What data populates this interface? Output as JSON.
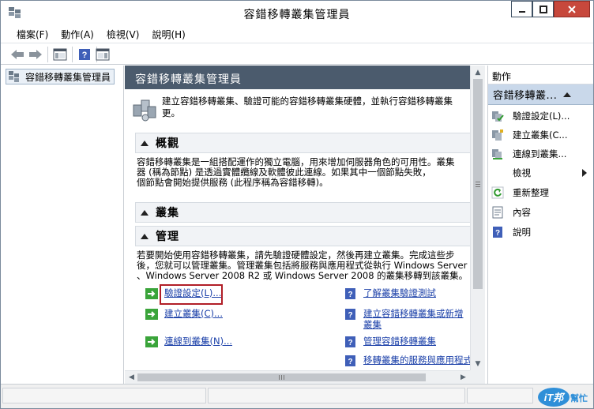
{
  "window": {
    "title": "容錯移轉叢集管理員",
    "controls": {
      "minimize": "minimize",
      "maximize": "maximize",
      "close": "close"
    }
  },
  "menubar": {
    "items": [
      "檔案(F)",
      "動作(A)",
      "檢視(V)",
      "說明(H)"
    ]
  },
  "toolbar": {
    "buttons": [
      "back-arrow-icon",
      "forward-arrow-icon",
      "show-tree-icon",
      "help-icon",
      "show-action-pane-icon"
    ]
  },
  "tree": {
    "root_label": "容錯移轉叢集管理員"
  },
  "center": {
    "header": "容錯移轉叢集管理員",
    "intro_line1": "建立容錯移轉叢集、驗證可能的容錯移轉叢集硬體，並執行容錯移轉叢集",
    "intro_line2": "更。",
    "overview": {
      "title": "概觀",
      "line1": "容錯移轉叢集是一組搭配運作的獨立電腦，用來增加伺服器角色的可用性。叢集",
      "line2": "器 (稱為節點) 是透過實體纜線及軟體彼此連線。如果其中一個節點失敗，",
      "line3": "個節點會開始提供服務 (此程序稱為容錯移轉)。"
    },
    "clusters": {
      "title": "叢集"
    },
    "management": {
      "title": "管理",
      "line1": "若要開始使用容錯移轉叢集，請先驗證硬體設定，然後再建立叢集。完成這些步",
      "line2": "後，您就可以管理叢集。管理叢集包括將服務與應用程式從執行 Windows Server",
      "line3": "、Windows Server 2008 R2 或 Windows Server 2008 的叢集移轉到該叢集。",
      "left_links": [
        "驗證設定(L)...",
        "建立叢集(C)...",
        "連線到叢集(N)..."
      ],
      "right_links": [
        [
          "了解叢集驗證測試"
        ],
        [
          "建立容錯移轉叢集或新增",
          "叢集"
        ],
        [
          "管理容錯移轉叢集"
        ],
        [
          "移轉叢集的服務與應用程式"
        ]
      ]
    }
  },
  "actions": {
    "header": "動作",
    "group": "容錯移轉叢...",
    "items": [
      "驗證設定(L)...",
      "建立叢集(C...",
      "連線到叢集...",
      "檢視",
      "重新整理",
      "內容",
      "說明"
    ]
  },
  "watermark": {
    "text1": "iT邦",
    "text2": "幫忙"
  },
  "colors": {
    "header_bg": "#4b5b6d",
    "link": "#1a3fa8",
    "focus_border": "#b11e27",
    "close_button": "#c7483c",
    "selection": "#c9d8ea"
  }
}
